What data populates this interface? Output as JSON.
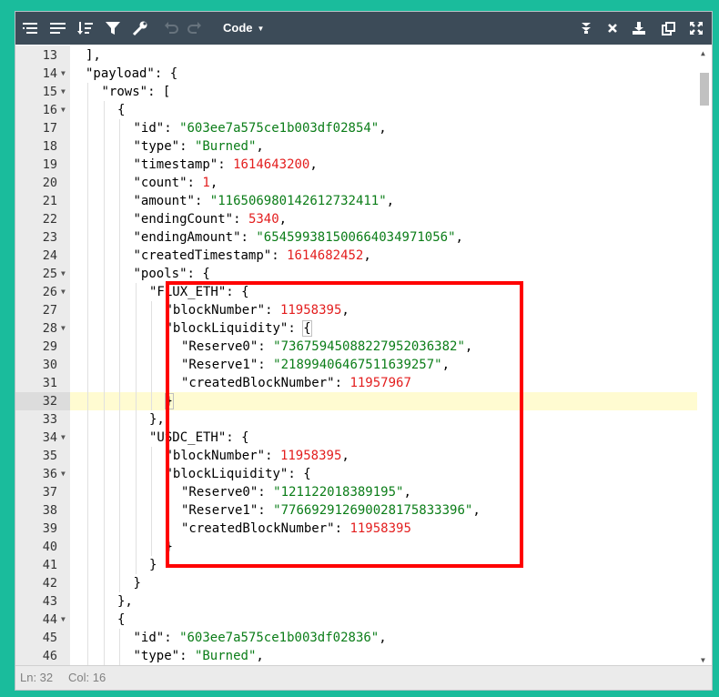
{
  "toolbar": {
    "mode_label": "Code",
    "icons": [
      "format-icon",
      "compact-icon",
      "sort-icon",
      "filter-icon",
      "transform-icon",
      "undo-icon",
      "redo-icon",
      "mode-dropdown",
      "collapse-all-icon",
      "remove-icon",
      "save-icon",
      "copy-icon",
      "fullscreen-icon"
    ]
  },
  "colors": {
    "background": "#1abc9c",
    "toolbar": "#3c4b58",
    "key": "#000000",
    "string": "#0b7d18",
    "number": "#e31e1e",
    "highlight_box": "#ff0000",
    "active_line": "#fffbd1"
  },
  "editor": {
    "active_line": 32,
    "lines": [
      {
        "n": "13",
        "fold": false,
        "indent": 1,
        "tokens": [
          [
            "p",
            "],"
          ]
        ]
      },
      {
        "n": "14",
        "fold": true,
        "indent": 1,
        "tokens": [
          [
            "k",
            "\"payload\""
          ],
          [
            "p",
            ": {"
          ]
        ]
      },
      {
        "n": "15",
        "fold": true,
        "indent": 2,
        "tokens": [
          [
            "k",
            "\"rows\""
          ],
          [
            "p",
            ": ["
          ]
        ]
      },
      {
        "n": "16",
        "fold": true,
        "indent": 3,
        "tokens": [
          [
            "p",
            "{"
          ]
        ]
      },
      {
        "n": "17",
        "fold": false,
        "indent": 4,
        "tokens": [
          [
            "k",
            "\"id\""
          ],
          [
            "p",
            ": "
          ],
          [
            "s",
            "\"603ee7a575ce1b003df02854\""
          ],
          [
            "p",
            ","
          ]
        ]
      },
      {
        "n": "18",
        "fold": false,
        "indent": 4,
        "tokens": [
          [
            "k",
            "\"type\""
          ],
          [
            "p",
            ": "
          ],
          [
            "s",
            "\"Burned\""
          ],
          [
            "p",
            ","
          ]
        ]
      },
      {
        "n": "19",
        "fold": false,
        "indent": 4,
        "tokens": [
          [
            "k",
            "\"timestamp\""
          ],
          [
            "p",
            ": "
          ],
          [
            "n",
            "1614643200"
          ],
          [
            "p",
            ","
          ]
        ]
      },
      {
        "n": "20",
        "fold": false,
        "indent": 4,
        "tokens": [
          [
            "k",
            "\"count\""
          ],
          [
            "p",
            ": "
          ],
          [
            "n",
            "1"
          ],
          [
            "p",
            ","
          ]
        ]
      },
      {
        "n": "21",
        "fold": false,
        "indent": 4,
        "tokens": [
          [
            "k",
            "\"amount\""
          ],
          [
            "p",
            ": "
          ],
          [
            "s",
            "\"116506980142612732411\""
          ],
          [
            "p",
            ","
          ]
        ]
      },
      {
        "n": "22",
        "fold": false,
        "indent": 4,
        "tokens": [
          [
            "k",
            "\"endingCount\""
          ],
          [
            "p",
            ": "
          ],
          [
            "n",
            "5340"
          ],
          [
            "p",
            ","
          ]
        ]
      },
      {
        "n": "23",
        "fold": false,
        "indent": 4,
        "tokens": [
          [
            "k",
            "\"endingAmount\""
          ],
          [
            "p",
            ": "
          ],
          [
            "s",
            "\"65459938150066403497105⁠⁠⁠6\""
          ],
          [
            "p",
            ","
          ]
        ]
      },
      {
        "n": "24",
        "fold": false,
        "indent": 4,
        "tokens": [
          [
            "k",
            "\"createdTimestamp\""
          ],
          [
            "p",
            ": "
          ],
          [
            "n",
            "1614682452"
          ],
          [
            "p",
            ","
          ]
        ]
      },
      {
        "n": "25",
        "fold": true,
        "indent": 4,
        "tokens": [
          [
            "k",
            "\"pools\""
          ],
          [
            "p",
            ": {"
          ]
        ]
      },
      {
        "n": "26",
        "fold": true,
        "indent": 5,
        "tokens": [
          [
            "k",
            "\"FLUX_ETH\""
          ],
          [
            "p",
            ": {"
          ]
        ]
      },
      {
        "n": "27",
        "fold": false,
        "indent": 6,
        "tokens": [
          [
            "k",
            "\"blockNumber\""
          ],
          [
            "p",
            ": "
          ],
          [
            "n",
            "11958395"
          ],
          [
            "p",
            ","
          ]
        ]
      },
      {
        "n": "28",
        "fold": true,
        "indent": 6,
        "tokens": [
          [
            "k",
            "\"blockLiquidity\""
          ],
          [
            "p",
            ": "
          ],
          [
            "p",
            "{"
          ]
        ]
      },
      {
        "n": "29",
        "fold": false,
        "indent": 7,
        "tokens": [
          [
            "k",
            "\"Reserve0\""
          ],
          [
            "p",
            ": "
          ],
          [
            "s",
            "\"73675945088227952036382\""
          ],
          [
            "p",
            ","
          ]
        ]
      },
      {
        "n": "30",
        "fold": false,
        "indent": 7,
        "tokens": [
          [
            "k",
            "\"Reserve1\""
          ],
          [
            "p",
            ": "
          ],
          [
            "s",
            "\"21899406467511639257\""
          ],
          [
            "p",
            ","
          ]
        ]
      },
      {
        "n": "31",
        "fold": false,
        "indent": 7,
        "tokens": [
          [
            "k",
            "\"createdBlockNumber\""
          ],
          [
            "p",
            ": "
          ],
          [
            "n",
            "11957967"
          ]
        ]
      },
      {
        "n": "32",
        "fold": false,
        "indent": 6,
        "tokens": [
          [
            "p",
            "}"
          ]
        ]
      },
      {
        "n": "33",
        "fold": false,
        "indent": 5,
        "tokens": [
          [
            "p",
            "},"
          ]
        ]
      },
      {
        "n": "34",
        "fold": true,
        "indent": 5,
        "tokens": [
          [
            "k",
            "\"USDC_ETH\""
          ],
          [
            "p",
            ": {"
          ]
        ]
      },
      {
        "n": "35",
        "fold": false,
        "indent": 6,
        "tokens": [
          [
            "k",
            "\"blockNumber\""
          ],
          [
            "p",
            ": "
          ],
          [
            "n",
            "11958395"
          ],
          [
            "p",
            ","
          ]
        ]
      },
      {
        "n": "36",
        "fold": true,
        "indent": 6,
        "tokens": [
          [
            "k",
            "\"blockLiquidity\""
          ],
          [
            "p",
            ": {"
          ]
        ]
      },
      {
        "n": "37",
        "fold": false,
        "indent": 7,
        "tokens": [
          [
            "k",
            "\"Reserve0\""
          ],
          [
            "p",
            ": "
          ],
          [
            "s",
            "\"121122018389195\""
          ],
          [
            "p",
            ","
          ]
        ]
      },
      {
        "n": "38",
        "fold": false,
        "indent": 7,
        "tokens": [
          [
            "k",
            "\"Reserve1\""
          ],
          [
            "p",
            ": "
          ],
          [
            "s",
            "\"776692912690028175833396\""
          ],
          [
            "p",
            ","
          ]
        ]
      },
      {
        "n": "39",
        "fold": false,
        "indent": 7,
        "tokens": [
          [
            "k",
            "\"createdBlockNumber\""
          ],
          [
            "p",
            ": "
          ],
          [
            "n",
            "11958395"
          ]
        ]
      },
      {
        "n": "40",
        "fold": false,
        "indent": 6,
        "tokens": [
          [
            "p",
            "}"
          ]
        ]
      },
      {
        "n": "41",
        "fold": false,
        "indent": 5,
        "tokens": [
          [
            "p",
            "}"
          ]
        ]
      },
      {
        "n": "42",
        "fold": false,
        "indent": 4,
        "tokens": [
          [
            "p",
            "}"
          ]
        ]
      },
      {
        "n": "43",
        "fold": false,
        "indent": 3,
        "tokens": [
          [
            "p",
            "},"
          ]
        ]
      },
      {
        "n": "44",
        "fold": true,
        "indent": 3,
        "tokens": [
          [
            "p",
            "{"
          ]
        ]
      },
      {
        "n": "45",
        "fold": false,
        "indent": 4,
        "tokens": [
          [
            "k",
            "\"id\""
          ],
          [
            "p",
            ": "
          ],
          [
            "s",
            "\"603ee7a575ce1b003df02836\""
          ],
          [
            "p",
            ","
          ]
        ]
      },
      {
        "n": "46",
        "fold": false,
        "indent": 4,
        "tokens": [
          [
            "k",
            "\"type\""
          ],
          [
            "p",
            ": "
          ],
          [
            "s",
            "\"Burned\""
          ],
          [
            "p",
            ","
          ]
        ]
      }
    ]
  },
  "status": {
    "ln_label": "Ln: 32",
    "col_label": "Col: 16"
  }
}
